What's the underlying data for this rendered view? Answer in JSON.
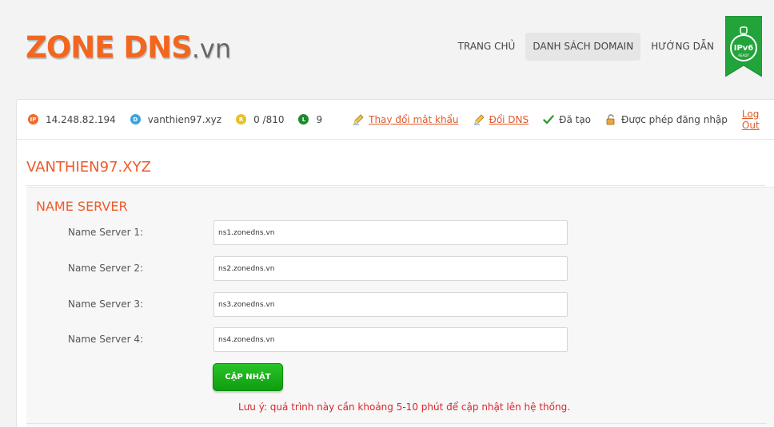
{
  "logo": {
    "brand": "ZONE DNS",
    "tld": ".vn"
  },
  "nav": {
    "items": [
      {
        "label": "TRANG CHỦ",
        "active": false
      },
      {
        "label": "DANH SÁCH DOMAIN",
        "active": true
      },
      {
        "label": "HƯỚNG DẪN",
        "active": false
      }
    ]
  },
  "badge": {
    "label": "IPv6",
    "sublabel": "READY"
  },
  "infobar": {
    "ip": {
      "tag": "IP",
      "value": "14.248.82.194"
    },
    "domain": {
      "tag": "D",
      "value": "vanthien97.xyz"
    },
    "records": {
      "tag": "R",
      "value": "0 /810"
    },
    "level": {
      "tag": "L",
      "value": "9"
    },
    "change_password": "Thay đổi mật khẩu",
    "change_dns": "Đổi DNS",
    "created": "Đã tạo",
    "login_allowed": "Được phép đăng nhập",
    "logout": "Log Out"
  },
  "domain_title": "VANTHIEN97.XYZ",
  "nameserver": {
    "title": "NAME SERVER",
    "rows": [
      {
        "label": "Name Server 1:",
        "value": "ns1.zonedns.vn"
      },
      {
        "label": "Name Server 2:",
        "value": "ns2.zonedns.vn"
      },
      {
        "label": "Name Server 3:",
        "value": "ns3.zonedns.vn"
      },
      {
        "label": "Name Server 4:",
        "value": "ns4.zonedns.vn"
      }
    ],
    "submit_label": "CẬP NHẬT",
    "note": "Lưu ý: quá trình này cần khoảng 5-10 phút để cập nhật lên hệ thống."
  },
  "colors": {
    "accent": "#ef5a2a",
    "button": "#1aad1a",
    "note": "#d9262a"
  }
}
